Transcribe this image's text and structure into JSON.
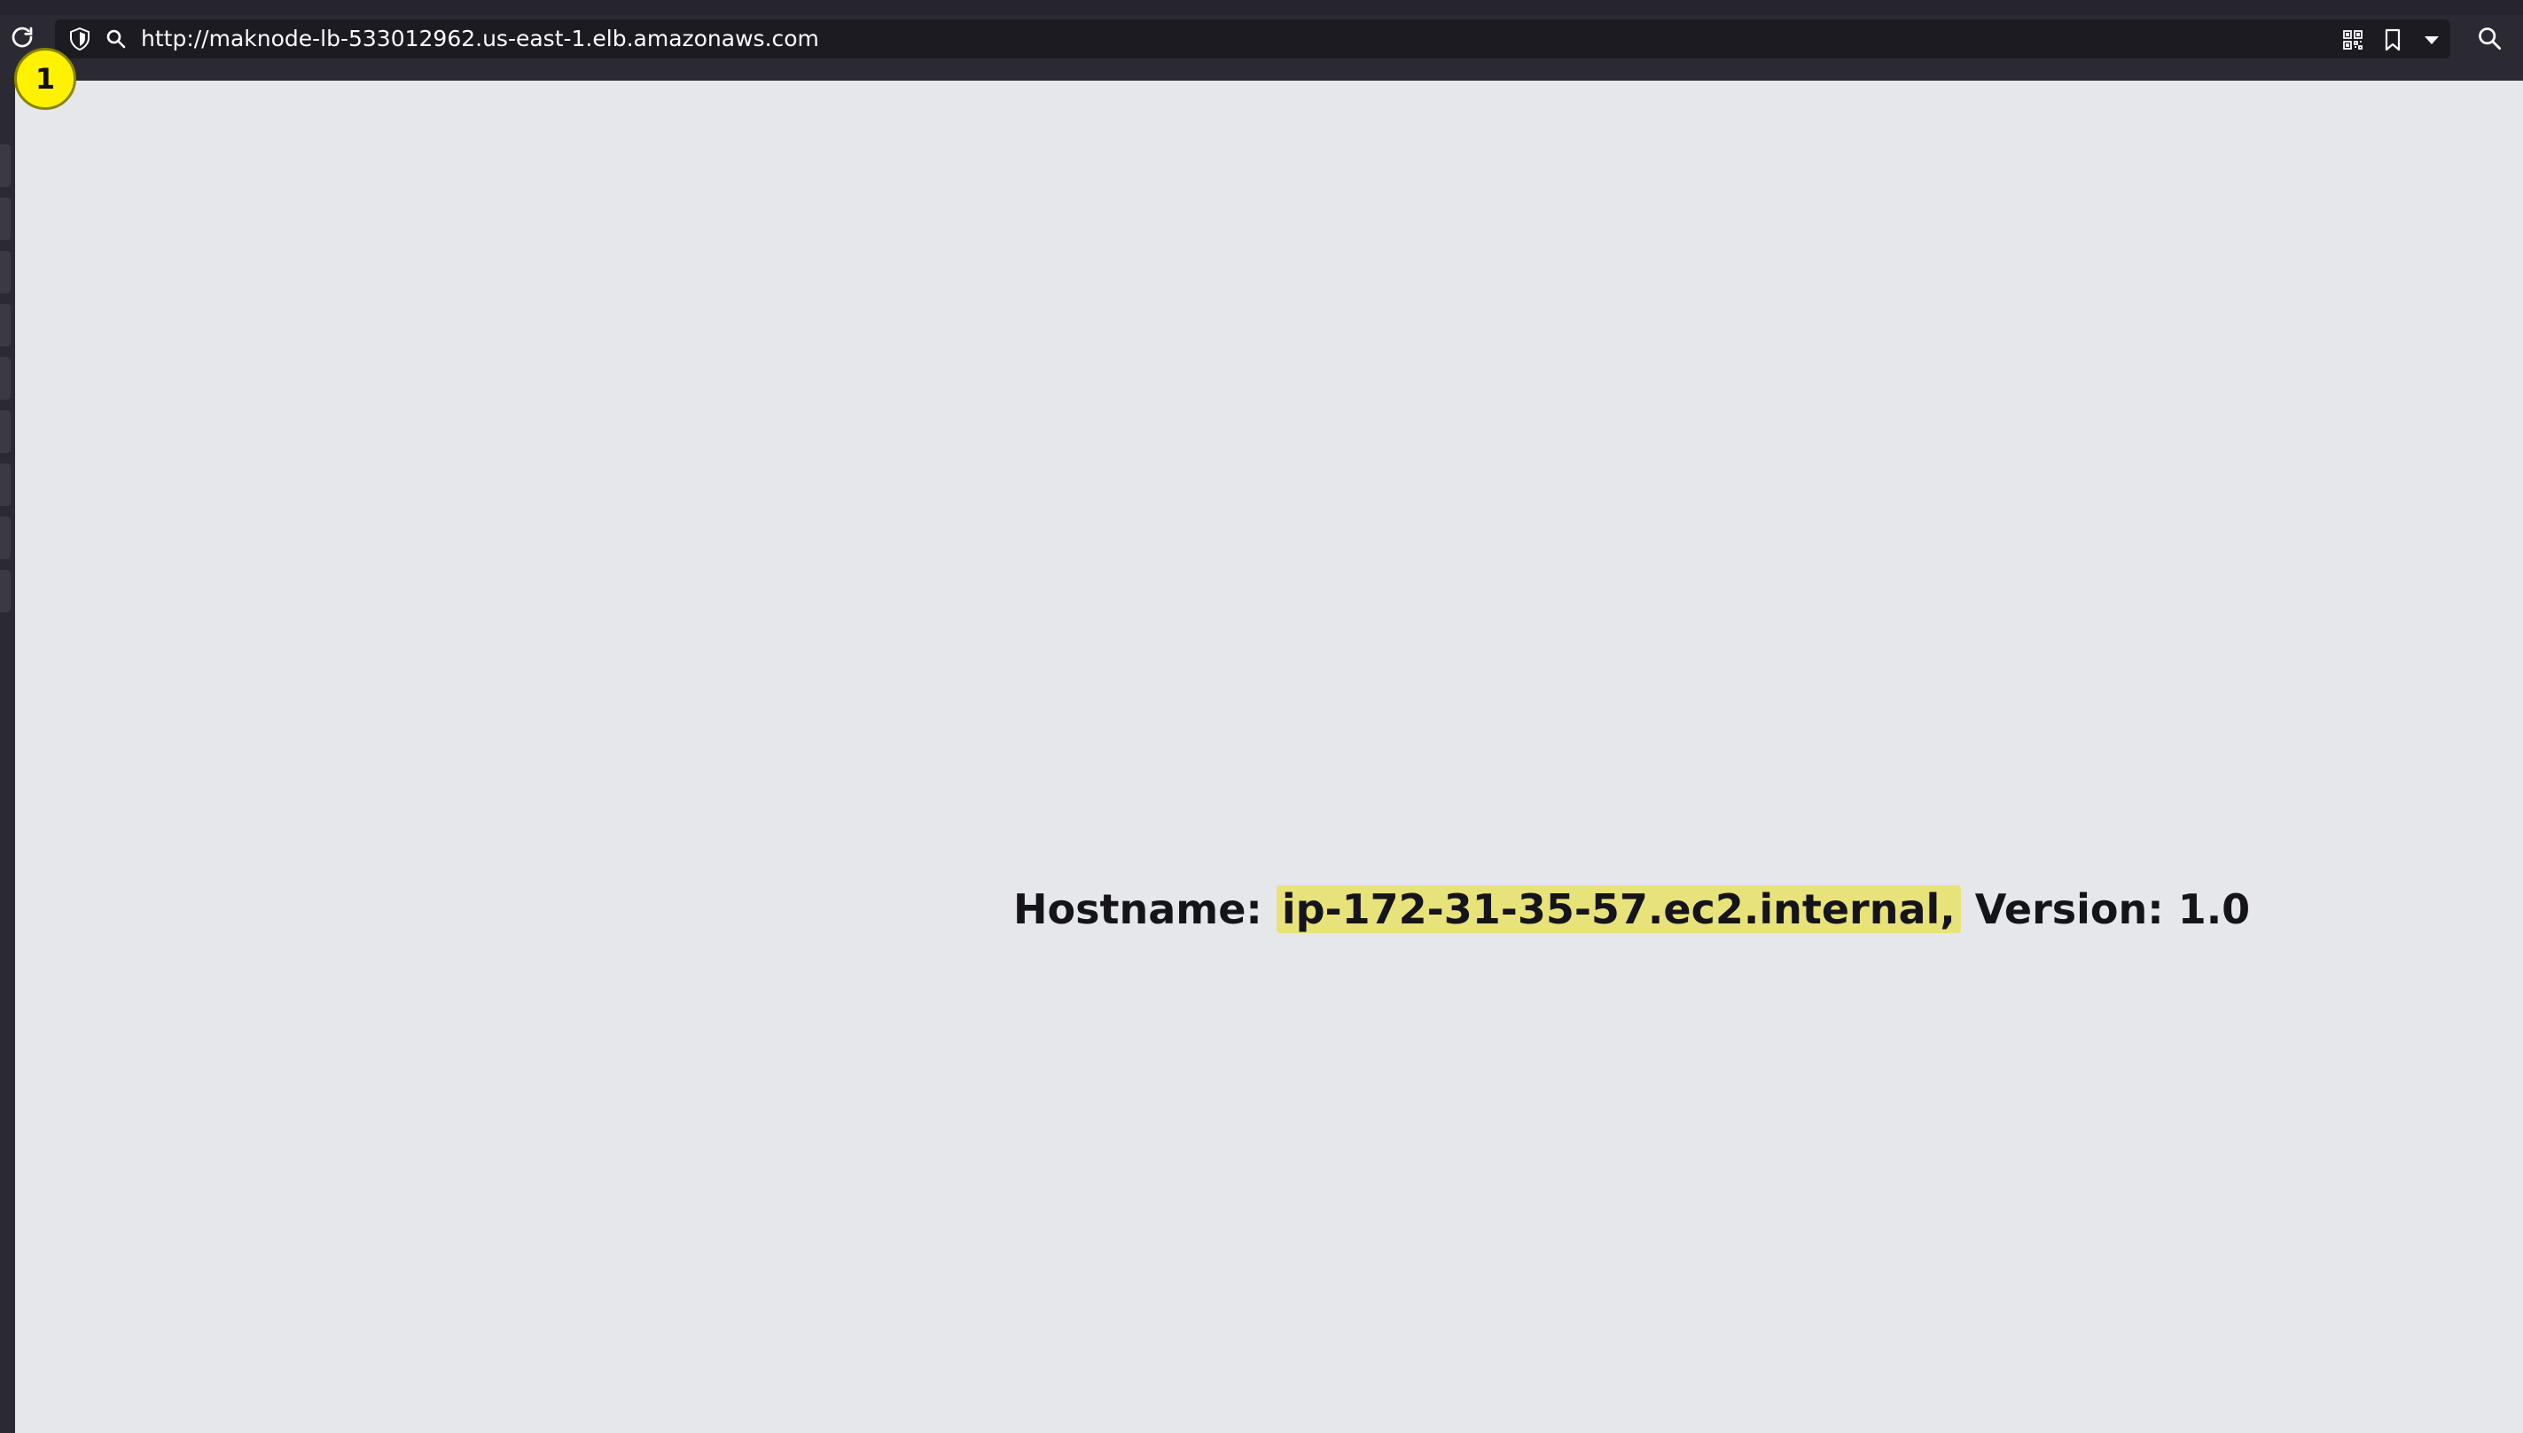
{
  "browser": {
    "url": "http://maknode-lb-533012962.us-east-1.elb.amazonaws.com",
    "icons": {
      "reload": "reload-icon",
      "shield": "shield-icon",
      "url_search": "search-icon",
      "qr": "qr-code-icon",
      "bookmark": "bookmark-icon",
      "dropdown": "chevron-down-icon",
      "toolbar_search": "search-icon"
    }
  },
  "step_marker": {
    "label": "1"
  },
  "page": {
    "hostname_label": "Hostname:",
    "hostname_value": "ip-172-31-35-57.ec2.internal,",
    "version_label": "Version:",
    "version_value": "1.0"
  },
  "colors": {
    "page_background": "#e6e7ea",
    "toolbar": "#2b2a33",
    "urlbar": "#1c1b22",
    "marker": "#fff200",
    "highlight": "#e8e27a"
  }
}
